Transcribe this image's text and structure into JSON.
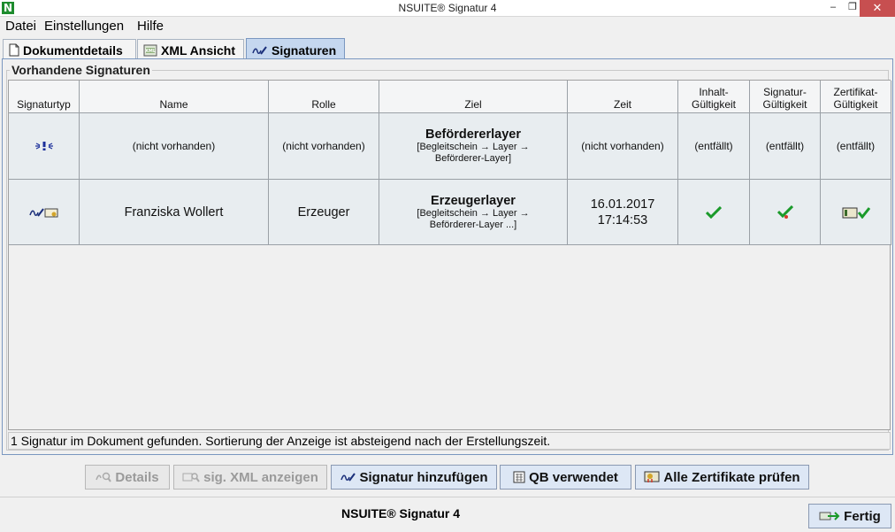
{
  "window": {
    "app_icon_letter": "N",
    "title": "NSUITE® Signatur 4",
    "minimize": "–",
    "maximize": "❐",
    "close": "✕"
  },
  "menu": [
    {
      "label": "Datei"
    },
    {
      "label": "Einstellungen"
    },
    {
      "label": "Hilfe"
    }
  ],
  "tabs": [
    {
      "label": "Dokumentdetails",
      "icon": "document-icon",
      "active": false
    },
    {
      "label": "XML Ansicht",
      "icon": "xml-icon",
      "active": false
    },
    {
      "label": "Signaturen",
      "icon": "signature-icon",
      "active": true
    }
  ],
  "group_title": "Vorhandene Signaturen",
  "table": {
    "headers": {
      "typ": "Signaturtyp",
      "name": "Name",
      "rolle": "Rolle",
      "ziel": "Ziel",
      "zeit": "Zeit",
      "inhalt_1": "Inhalt-",
      "inhalt_2": "Gültigkeit",
      "signatur_1": "Signatur-",
      "signatur_2": "Gültigkeit",
      "zertifikat_1": "Zertifikat-",
      "zertifikat_2": "Gültigkeit"
    },
    "rows": [
      {
        "typ_icon": "missing-signature-icon",
        "name": "(nicht vorhanden)",
        "rolle": "(nicht vorhanden)",
        "ziel_title": "Befördererlayer",
        "ziel_path_1": "[Begleitschein → Layer →",
        "ziel_path_2": "Beförderer-Layer]",
        "zeit_1": "(nicht vorhanden)",
        "zeit_2": "",
        "inhalt": "(entfällt)",
        "signatur": "(entfällt)",
        "zertifikat": "(entfällt)"
      },
      {
        "typ_icon": "signature-certificate-icon",
        "name": "Franziska Wollert",
        "rolle": "Erzeuger",
        "ziel_title": "Erzeugerlayer",
        "ziel_path_1": "[Begleitschein → Layer →",
        "ziel_path_2": "Beförderer-Layer ...]",
        "zeit_1": "16.01.2017",
        "zeit_2": "17:14:53",
        "inhalt_icon": "check-icon",
        "signatur_icon": "check-warning-icon",
        "zertifikat_icon": "certificate-check-icon"
      }
    ]
  },
  "status_text": "1 Signatur im Dokument gefunden. Sortierung der Anzeige ist absteigend nach der Erstellungszeit.",
  "buttons": {
    "details": "Details",
    "sig_xml": "sig. XML anzeigen",
    "add_signature": "Signatur hinzufügen",
    "qb": "QB verwendet",
    "check_certs": "Alle Zertifikate prüfen",
    "fertig": "Fertig"
  },
  "footer_title": "NSUITE® Signatur 4",
  "colors": {
    "accent": "#c5d7ef",
    "close": "#c74f50",
    "check": "#1a9a2a"
  }
}
